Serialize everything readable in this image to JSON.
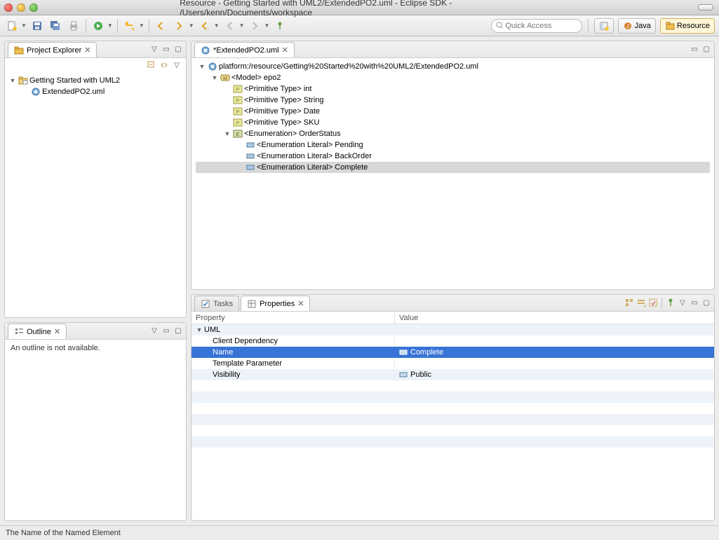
{
  "window": {
    "title": "Resource - Getting Started with UML2/ExtendedPO2.uml - Eclipse SDK - /Users/kenn/Documents/workspace"
  },
  "toolbar": {
    "quick_access_placeholder": "Quick Access"
  },
  "perspectives": {
    "java": "Java",
    "resource": "Resource"
  },
  "project_explorer": {
    "title": "Project Explorer",
    "project": "Getting Started with UML2",
    "file": "ExtendedPO2.uml"
  },
  "outline": {
    "title": "Outline",
    "message": "An outline is not available."
  },
  "editor": {
    "tab_title": "*ExtendedPO2.uml",
    "resource_path": "platform:/resource/Getting%20Started%20with%20UML2/ExtendedPO2.uml",
    "model_name": "<Model> epo2",
    "prim_int": "<Primitive Type> int",
    "prim_string": "<Primitive Type> String",
    "prim_date": "<Primitive Type> Date",
    "prim_sku": "<Primitive Type> SKU",
    "enum_name": "<Enumeration> OrderStatus",
    "lit_pending": "<Enumeration Literal> Pending",
    "lit_backorder": "<Enumeration Literal> BackOrder",
    "lit_complete": "<Enumeration Literal> Complete"
  },
  "bottom_tabs": {
    "tasks": "Tasks",
    "properties": "Properties"
  },
  "properties": {
    "header_property": "Property",
    "header_value": "Value",
    "category": "UML",
    "row1": "Client Dependency",
    "row2": "Name",
    "row2_value": "Complete",
    "row3": "Template Parameter",
    "row4": "Visibility",
    "row4_value": "Public"
  },
  "status_bar": "The Name of the Named Element"
}
